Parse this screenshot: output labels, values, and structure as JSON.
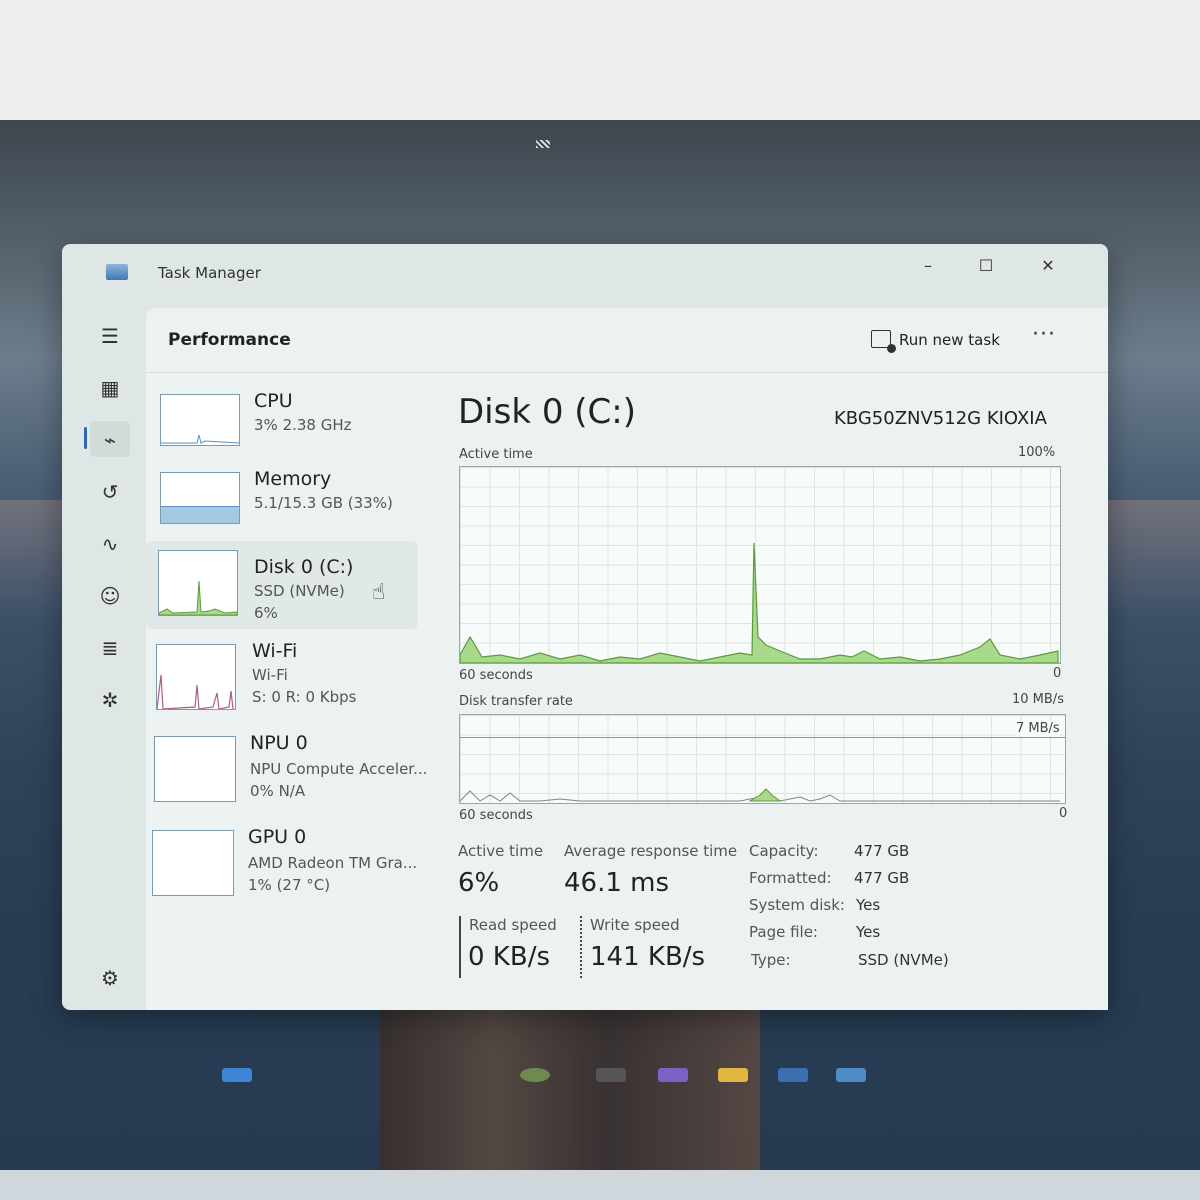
{
  "window": {
    "title": "Task Manager"
  },
  "page": {
    "title": "Performance",
    "run_new_task": "Run new task"
  },
  "icons": {
    "hamburger": "menu-icon",
    "processes": "processes-icon",
    "performance": "performance-icon",
    "app_history": "app-history-icon",
    "startup": "startup-icon",
    "users": "users-icon",
    "details": "details-icon",
    "services": "services-icon",
    "settings": "settings-icon"
  },
  "sidebar": {
    "items": [
      {
        "name": "CPU",
        "line1": "3% 2.38 GHz",
        "line2": ""
      },
      {
        "name": "Memory",
        "line1": "5.1/15.3 GB (33%)",
        "line2": ""
      },
      {
        "name": "Disk 0 (C:)",
        "line1": "SSD (NVMe)",
        "line2": "6%"
      },
      {
        "name": "Wi-Fi",
        "line1": "Wi-Fi",
        "line2": "S: 0 R: 0 Kbps"
      },
      {
        "name": "NPU 0",
        "line1": "NPU Compute Acceler...",
        "line2": "0% N/A"
      },
      {
        "name": "GPU 0",
        "line1": "AMD Radeon TM Gra...",
        "line2": "1% (27 °C)"
      }
    ]
  },
  "detail": {
    "title": "Disk 0 (C:)",
    "model": "KBG50ZNV512G KIOXIA",
    "chart1": {
      "label": "Active time",
      "max": "100%",
      "span": "60 seconds",
      "min": "0"
    },
    "chart2": {
      "label": "Disk transfer rate",
      "max": "10 MB/s",
      "line_label": "7 MB/s",
      "span": "60 seconds",
      "min": "0"
    },
    "stats": {
      "active_time_label": "Active time",
      "active_time_value": "6%",
      "avg_resp_label": "Average response time",
      "avg_resp_value": "46.1 ms",
      "read_label": "Read speed",
      "read_value": "0 KB/s",
      "write_label": "Write speed",
      "write_value": "141 KB/s"
    },
    "properties": [
      {
        "key": "Capacity:",
        "value": "477 GB"
      },
      {
        "key": "Formatted:",
        "value": "477 GB"
      },
      {
        "key": "System disk:",
        "value": "Yes"
      },
      {
        "key": "Page file:",
        "value": "Yes"
      },
      {
        "key": "Type:",
        "value": "SSD (NVMe)"
      }
    ]
  },
  "colors": {
    "disk_graph_fill": "#a9d98a",
    "disk_graph_line": "#5c9a3c",
    "accent": "#2b6bb5"
  }
}
